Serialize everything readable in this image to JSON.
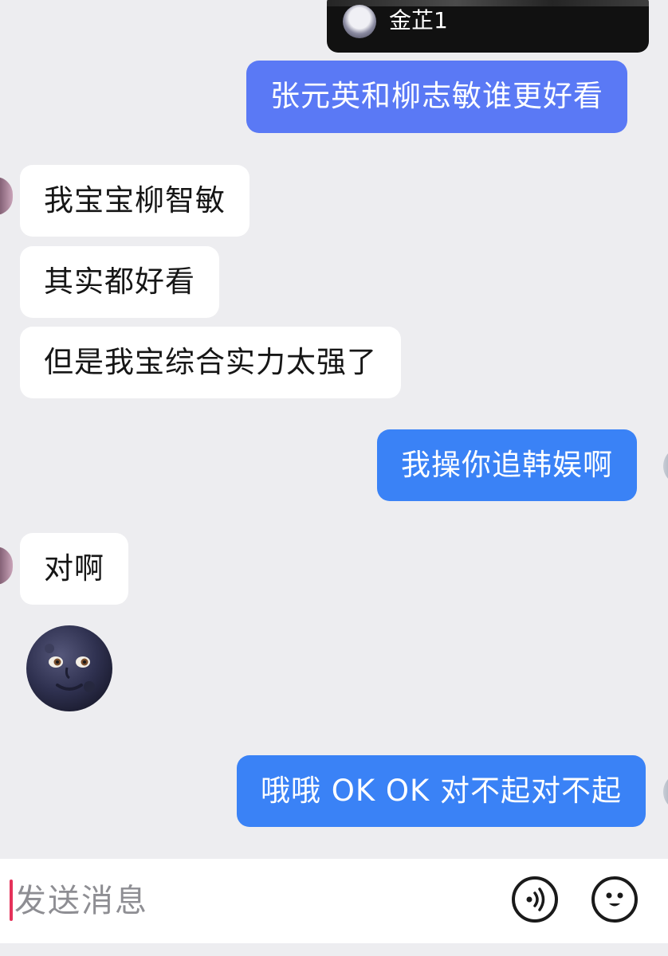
{
  "shared_video": {
    "author": "金芷1"
  },
  "messages": [
    {
      "id": "m1",
      "side": "right",
      "text": "张元英和柳志敏谁更好看"
    },
    {
      "id": "m2",
      "side": "left",
      "text": "我宝宝柳智敏"
    },
    {
      "id": "m3",
      "side": "left",
      "text": "其实都好看"
    },
    {
      "id": "m4",
      "side": "left",
      "text": "但是我宝综合实力太强了"
    },
    {
      "id": "m5",
      "side": "right",
      "text": "我操你追韩娱啊"
    },
    {
      "id": "m6",
      "side": "left",
      "text": "对啊"
    },
    {
      "id": "m7",
      "side": "left",
      "type": "emoji",
      "emoji": "new-moon-face"
    },
    {
      "id": "m8",
      "side": "right",
      "text": "哦哦 OK OK 对不起对不起"
    }
  ],
  "composer": {
    "placeholder": "发送消息",
    "voice_icon": "voice-icon",
    "emoji_icon": "emoji-icon"
  },
  "colors": {
    "outgoing_bubble": "#3a82f6",
    "incoming_bubble": "#ffffff",
    "background": "#ededf0"
  }
}
